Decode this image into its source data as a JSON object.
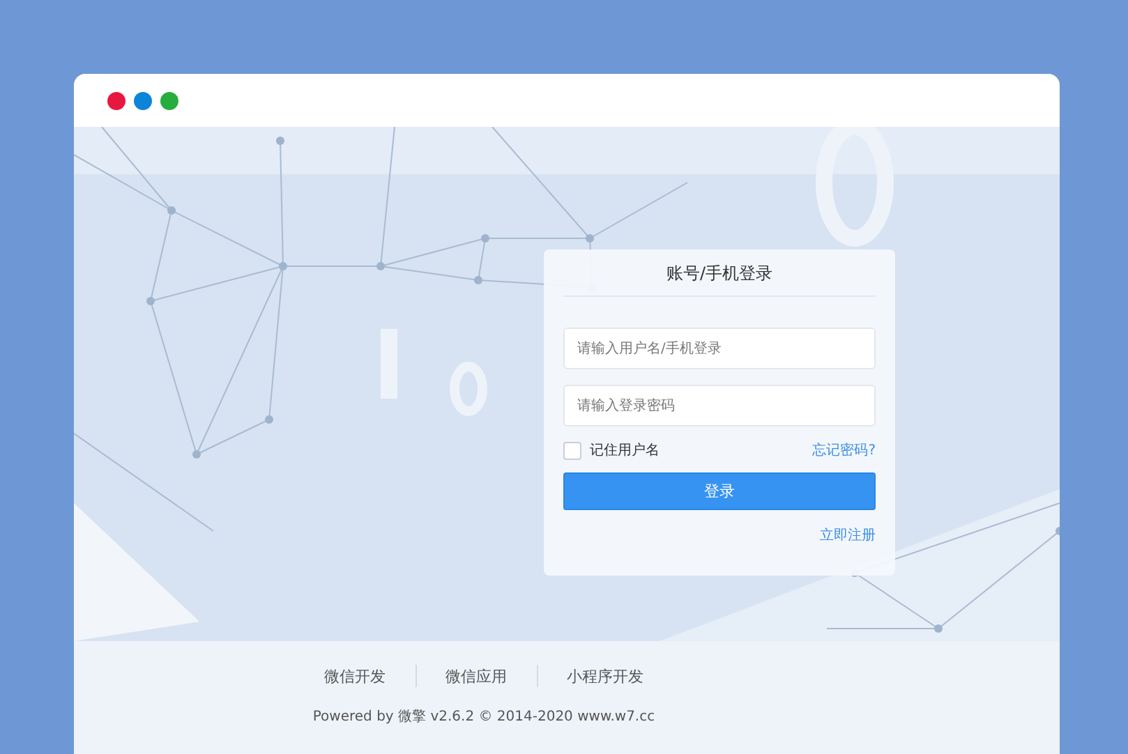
{
  "window": {
    "dots": [
      {
        "color": "#e8173f"
      },
      {
        "color": "#0c84d9"
      },
      {
        "color": "#27ad3d"
      }
    ]
  },
  "login": {
    "title": "账号/手机登录",
    "fields": [
      {
        "placeholder": "请输入用户名/手机登录"
      },
      {
        "placeholder": "请输入登录密码"
      }
    ],
    "remember": {
      "label": "记住用户名",
      "checked": false
    },
    "forgot": "忘记密码?",
    "submit": "登录",
    "register": "立即注册"
  },
  "footer": {
    "links": [
      "微信开发",
      "微信应用",
      "小程序开发"
    ],
    "copyright": "Powered by 微擎 v2.6.2 © 2014-2020 www.w7.cc"
  }
}
